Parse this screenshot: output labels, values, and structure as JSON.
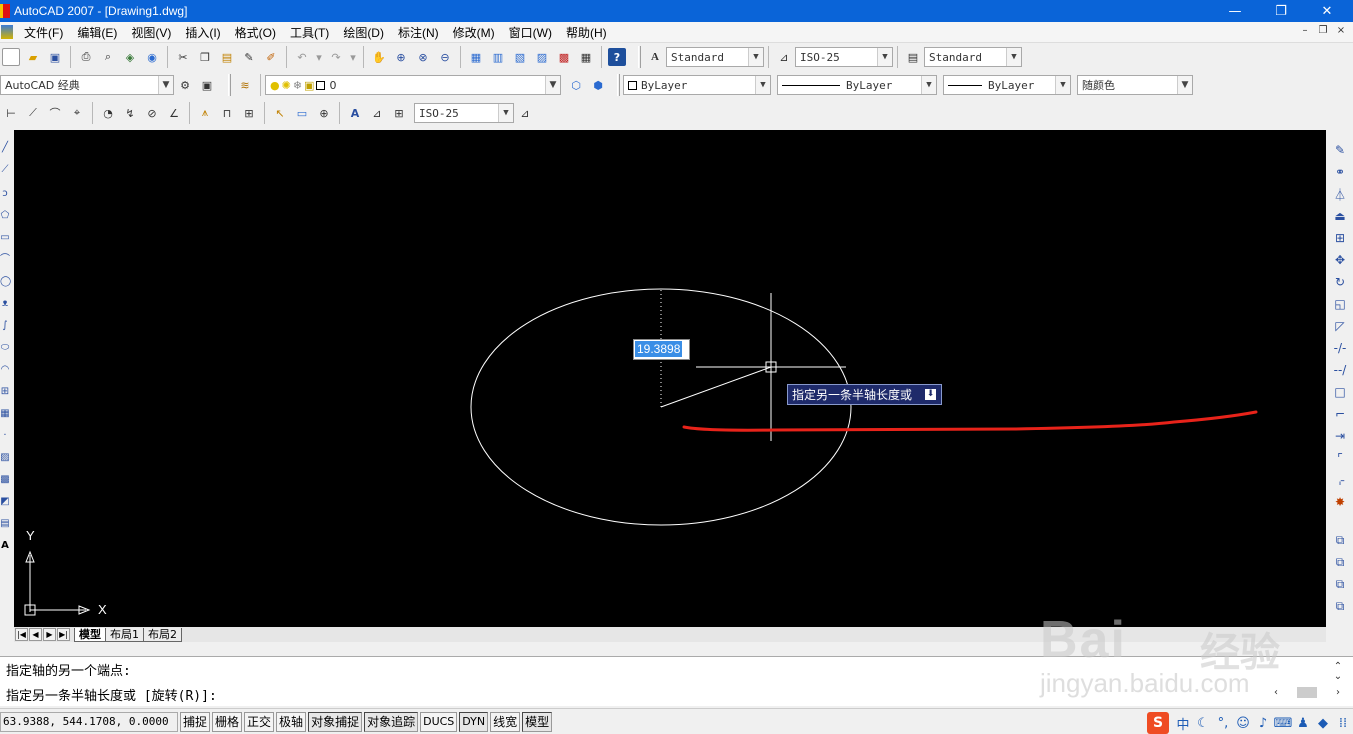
{
  "window": {
    "title": "AutoCAD 2007 - [Drawing1.dwg]",
    "minimize": "—",
    "restore": "❐",
    "close": "✕"
  },
  "menu": {
    "items": [
      "文件(F)",
      "编辑(E)",
      "视图(V)",
      "插入(I)",
      "格式(O)",
      "工具(T)",
      "绘图(D)",
      "标注(N)",
      "修改(M)",
      "窗口(W)",
      "帮助(H)"
    ],
    "mdi_minimize": "–",
    "mdi_restore": "❐",
    "mdi_close": "×"
  },
  "toolbar_styles": {
    "text_style": "Standard",
    "dim_style": "ISO-25",
    "table_style": "Standard"
  },
  "toolbar_layers": {
    "workspace": "AutoCAD 经典",
    "layer": "0",
    "color": "ByLayer",
    "linetype": "ByLayer",
    "lineweight": "ByLayer",
    "plot_style": "随颜色"
  },
  "toolbar_dim": {
    "dim_style": "ISO-25"
  },
  "drawing": {
    "dynamic_input_value": "19.3898",
    "dynamic_prompt": "指定另一条半轴长度或",
    "ucs_x": "X",
    "ucs_y": "Y"
  },
  "layout_tabs": {
    "nav": [
      "|◀",
      "◀",
      "▶",
      "▶|"
    ],
    "tabs": [
      {
        "label": "模型",
        "active": true
      },
      {
        "label": "布局1",
        "active": false
      },
      {
        "label": "布局2",
        "active": false
      }
    ]
  },
  "command": {
    "history_line": "指定轴的另一个端点:",
    "current_line": "指定另一条半轴长度或 [旋转(R)]:"
  },
  "status": {
    "coordinates": "63.9388, 544.1708, 0.0000",
    "buttons": [
      {
        "label": "捕捉",
        "on": false
      },
      {
        "label": "栅格",
        "on": false
      },
      {
        "label": "正交",
        "on": false
      },
      {
        "label": "极轴",
        "on": false
      },
      {
        "label": "对象捕捉",
        "on": true
      },
      {
        "label": "对象追踪",
        "on": true
      },
      {
        "label": "DUCS",
        "on": false
      },
      {
        "label": "DYN",
        "on": true
      },
      {
        "label": "线宽",
        "on": false
      },
      {
        "label": "模型",
        "on": true
      }
    ],
    "ime_logo": "S",
    "ime_lang": "中"
  },
  "watermark": {
    "brand": "Bai",
    "brand_cn": "经验",
    "url": "jingyan.baidu.com"
  },
  "colors": {
    "titlebar": "#0a64d8",
    "canvas": "#000000",
    "annotation_stroke": "#e8231a",
    "dyn_tip_bg": "#1e2a6a"
  }
}
